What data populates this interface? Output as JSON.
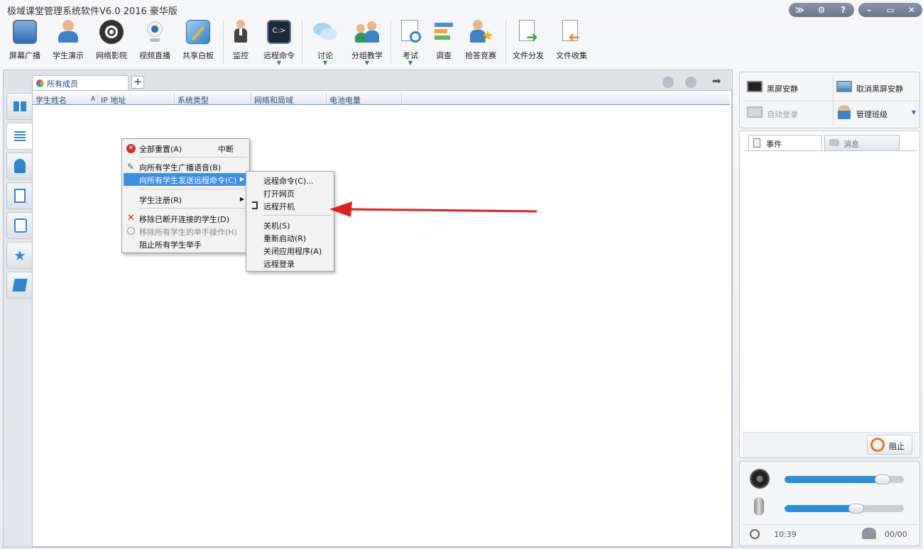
{
  "window": {
    "title": "极域课堂管理系统软件V6.0 2016 豪华版",
    "controls": [
      "≫",
      "⚙",
      "?",
      "–",
      "▭",
      "✕"
    ]
  },
  "toolbar": {
    "items": [
      {
        "label": "屏幕广播",
        "icon": "screen-broadcast-icon"
      },
      {
        "label": "学生演示",
        "icon": "student-demo-icon"
      },
      {
        "label": "网络影院",
        "icon": "film-reel-icon"
      },
      {
        "label": "视频直播",
        "icon": "webcam-icon"
      },
      {
        "label": "共享白板",
        "icon": "whiteboard-icon"
      },
      {
        "label": "监控",
        "icon": "monitor-person-icon"
      },
      {
        "label": "远程命令",
        "icon": "terminal-icon"
      },
      {
        "label": "讨论",
        "icon": "chat-bubbles-icon"
      },
      {
        "label": "分组教学",
        "icon": "group-icon"
      },
      {
        "label": "考试",
        "icon": "exam-clock-icon"
      },
      {
        "label": "调查",
        "icon": "survey-bars-icon"
      },
      {
        "label": "抢答竞赛",
        "icon": "quiz-star-icon"
      },
      {
        "label": "文件分发",
        "icon": "file-send-icon"
      },
      {
        "label": "文件收集",
        "icon": "file-collect-icon"
      }
    ]
  },
  "tabs": {
    "active_label": "所有成员",
    "add_label": "+"
  },
  "table": {
    "headers": [
      "学生姓名",
      "IP 地址",
      "系统类型",
      "网络和局域",
      "电池电量"
    ],
    "sort_indicator": "∧"
  },
  "context_menu": {
    "items": [
      {
        "label": "全部重置(A)",
        "shortcut": "中断",
        "icon": "x-circle-icon"
      },
      {
        "label": "向所有学生广播语音(B)",
        "icon": "microphone-icon"
      },
      {
        "label": "向所有学生发送远程命令(C)",
        "submenu": true
      },
      {
        "label": "学生注册(R)",
        "submenu": true
      },
      {
        "label": "移除已断开连接的学生(D)",
        "icon": "red-x-icon"
      },
      {
        "label": "移除所有学生的举手操作(H)",
        "disabled": true
      },
      {
        "label": "阻止所有学生举手"
      }
    ]
  },
  "submenu": {
    "items": [
      "远程命令(C)...",
      "打开网页",
      "远程开机",
      "关机(S)",
      "重新启动(R)",
      "关闭应用程序(A)",
      "远程登录"
    ]
  },
  "right_panel": {
    "actions": [
      "黑屏安静",
      "取消黑屏安静",
      "自动登录",
      "管理班级"
    ],
    "tabs": [
      "事件",
      "消息"
    ],
    "block_button": "阻止",
    "speaker_volume": 0.82,
    "mic_volume": 0.6,
    "time": "10:39",
    "count": "00/00"
  },
  "colors": {
    "accent": "#3d8ee6",
    "annotation_arrow": "#e02020",
    "slider": "#2b8fd6"
  }
}
